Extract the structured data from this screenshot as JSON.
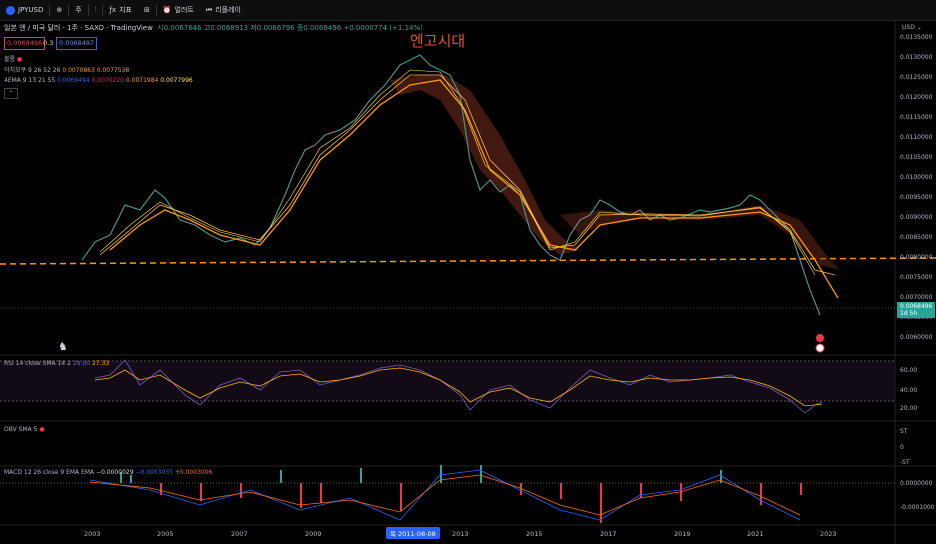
{
  "toolbar": {
    "symbol": "JPYUSD",
    "add_icon": "plus-circle-icon",
    "interval": "주",
    "chart_type_icon": "candles-icon",
    "indicators_label": "지표",
    "layout_icon": "grid-icon",
    "alert_label": "얼러트",
    "replay_label": "리플레이"
  },
  "header": {
    "title": "일본 엔 / 미국 달러",
    "interval": "1주",
    "exchange": "SAXO",
    "source": "TradingView",
    "ohlc": "시0.0067646 고0.0068913 저0.0066796 종0.0068496 +0.0000774 (+1.14%)"
  },
  "price_boxes": {
    "bid": "0.0068496",
    "spread": "0.3",
    "ask": "0.0068497"
  },
  "indicators": {
    "group_label": "볼롱",
    "ichimoku": "이치모쿠 9 26 52 26",
    "ichimoku_v1": "0.0070863",
    "ichimoku_v2": "0.0077538",
    "ema4": "4EMA 9 13 21 55",
    "ema_v1": "0.0069494",
    "ema_v2": "0.0070220",
    "ema_v3": "0.0071984",
    "ema_v4": "0.0077996"
  },
  "annotation": "엔고시대",
  "price_axis": {
    "currency": "USD",
    "ticks": [
      "0.0135000",
      "0.0130000",
      "0.0125000",
      "0.0120000",
      "0.0115000",
      "0.0110000",
      "0.0105000",
      "0.0100000",
      "0.0095000",
      "0.0090000",
      "0.0085000",
      "0.0080000",
      "0.0075000",
      "0.0070000",
      "0.0065000",
      "0.0060000"
    ],
    "last_price": "0.0068496",
    "countdown": "1d 5h"
  },
  "rsi": {
    "label": "RSI 14 close SMA 14 2",
    "v1": "28.00",
    "v2": "27.33",
    "ticks": [
      "60.00",
      "40.00",
      "20.00"
    ]
  },
  "obv": {
    "label": "OBV SMA 5",
    "ticks": [
      "ST",
      "0",
      "-ST"
    ]
  },
  "macd": {
    "label": "MACD 12 26 close 9 EMA EMA",
    "v1": "−0.0000029",
    "v2": "−0.0003035",
    "v3": "+0.0003006",
    "ticks": [
      "0.0000000",
      "-0.0001000"
    ]
  },
  "time_axis": {
    "years": [
      "2003",
      "2005",
      "2007",
      "2009",
      "2013",
      "2015",
      "2017",
      "2019",
      "2021",
      "2023"
    ],
    "cursor": "목 2011-08-08"
  },
  "colors": {
    "up": "#26a69a",
    "down": "#f23645",
    "accent": "#2962ff",
    "orange": "#ff9800",
    "annotation": "#e8502a"
  }
}
